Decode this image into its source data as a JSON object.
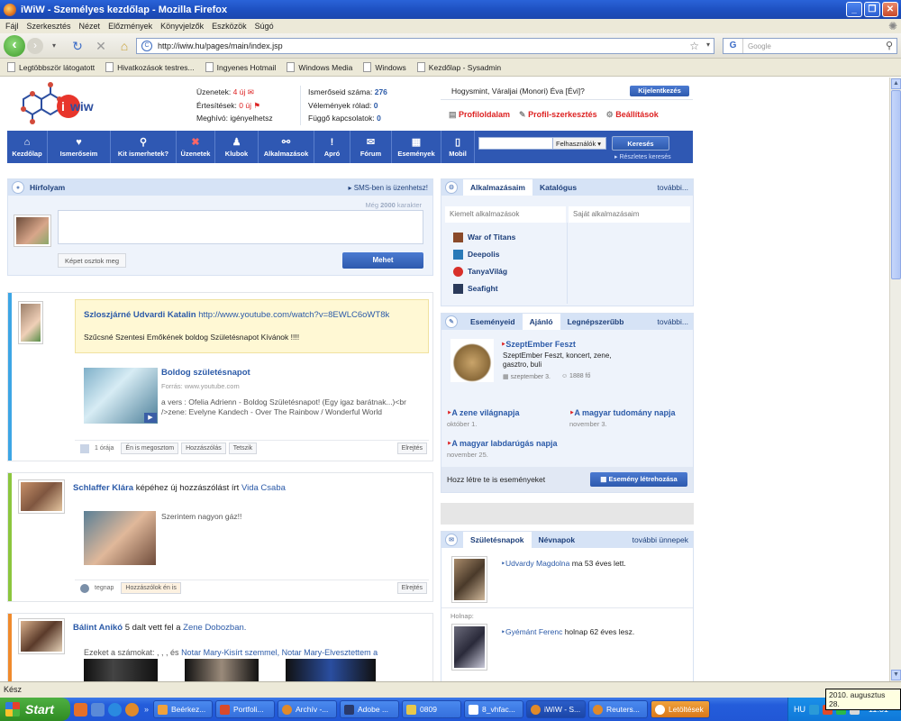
{
  "window": {
    "title": "iWiW - Személyes kezdőlap - Mozilla Firefox"
  },
  "menu": [
    "Fájl",
    "Szerkesztés",
    "Nézet",
    "Előzmények",
    "Könyvjelzők",
    "Eszközök",
    "Súgó"
  ],
  "address": {
    "url": "http://iwiw.hu/pages/main/index.jsp",
    "search_placeholder": "Google"
  },
  "bookmarks": [
    "Legtöbbször látogatott",
    "Hivatkozások testres...",
    "Ingyenes Hotmail",
    "Windows Media",
    "Windows",
    "Kezdőlap - Sysadmin"
  ],
  "header": {
    "col1": {
      "messages_label": "Üzenetek:",
      "messages_value": "4 új",
      "notifications_label": "Értesítések:",
      "notifications_value": "0 új",
      "invite_label": "Meghívó:",
      "invite_value": "igényelhetsz"
    },
    "col2": {
      "friends_label": "Ismerőseid száma:",
      "friends_value": "276",
      "opinions_label": "Vélemények rólad:",
      "opinions_value": "0",
      "pending_label": "Függő kapcsolatok:",
      "pending_value": "0"
    },
    "user_text": "Hogysmint, Váraljai (Monori) Éva [Évi]?",
    "logout": "Kijelentkezés",
    "profile_links": [
      "Profiloldalam",
      "Profil-szerkesztés",
      "Beállítások"
    ]
  },
  "nav": {
    "items": [
      "Kezdőlap",
      "Ismerőseim",
      "Kit ismerhetek?",
      "Üzenetek",
      "Klubok",
      "Alkalmazások",
      "Apró",
      "Fórum",
      "Események",
      "Mobil"
    ],
    "search_placeholder": "",
    "search_select": "Felhasználók",
    "search_button": "Keresés",
    "advanced": "Részletes keresés"
  },
  "feed": {
    "title": "Hírfolyam",
    "sms": "SMS-ben is üzenhetsz!",
    "chars_left_prefix": "Még",
    "chars_left_num": "2000",
    "chars_left_suffix": "karakter",
    "photo_share": "Képet osztok meg",
    "submit": "Mehet"
  },
  "posts": [
    {
      "author": "Szloszjárné Udvardi Katalin",
      "link": "http://www.youtube.com/watch?v=8EWLC6oWT8k",
      "text": "Szűcsné Szentesi Emőkének boldog Születésnapot Kívánok !!!!",
      "video_title": "Boldog születésnapot",
      "video_source": "Forrás: www.youtube.com",
      "video_desc": "a vers : Ofelia Adrienn - Boldog Születésnapot! (Egy igaz barátnak...)<br />zene: Evelyne Kandech - Over The Rainbow / Wonderful World",
      "time": "1 órája",
      "actions": [
        "Én is megosztom",
        "Hozzászólás",
        "Tetszik"
      ],
      "hide": "Elrejtés"
    },
    {
      "author": "Schlaffer Klára",
      "action_text": "képéhez új hozzászólást írt",
      "actor": "Vida Csaba",
      "comment": "Szerintem nagyon gáz!!",
      "time": "tegnap",
      "actions": [
        "Hozzászólok én is"
      ],
      "hide": "Elrejtés"
    },
    {
      "author": "Bálint Anikó",
      "action_text": "5 dalt vett fel a",
      "target": "Zene Dobozban.",
      "songs_prefix": "Ezeket a számokat: , , , és",
      "songs": "Notar Mary-Kisírt szemmel, Notar Mary-Elvesztettem a"
    }
  ],
  "apps": {
    "tabs": [
      "Alkalmazásaim",
      "Katalógus"
    ],
    "more": "további...",
    "featured": "Kiemelt alkalmazások",
    "own": "Saját alkalmazásaim",
    "items": [
      "War of Titans",
      "Deepolis",
      "TanyaVilág",
      "Seafight"
    ]
  },
  "events": {
    "tabs": [
      "Eseményeid",
      "Ajánló",
      "Legnépszerűbb"
    ],
    "more": "további...",
    "featured_title": "SzeptEmber Feszt",
    "featured_desc": "SzeptEmber Feszt, koncert, zene, gasztro, buli",
    "featured_date": "szeptember 3.",
    "featured_count": "1888 fő",
    "items": [
      {
        "title": "A zene világnapja",
        "date": "október 1."
      },
      {
        "title": "A magyar tudomány napja",
        "date": "november 3."
      },
      {
        "title": "A magyar labdarúgás napja",
        "date": "november 25."
      }
    ],
    "create_prompt": "Hozz létre te is eseményeket",
    "create_button": "Esemény létrehozása"
  },
  "birthdays": {
    "tabs": [
      "Születésnapok",
      "Névnapok"
    ],
    "more": "további ünnepek",
    "today_name": "Udvardy Magdolna",
    "today_text": "ma 53 éves lett.",
    "tomorrow_label": "Holnap:",
    "tomorrow_name": "Gyémánt Ferenc",
    "tomorrow_text": "holnap 62 éves lesz."
  },
  "status": {
    "text": "Kész",
    "tooltip": "2010. augusztus 28."
  },
  "taskbar": {
    "start": "Start",
    "tasks": [
      "Beérkez...",
      "Portfoli...",
      "Archív -...",
      "Adobe ...",
      "0809",
      "8_vhfac...",
      "iWiW - S...",
      "Reuters...",
      "Letöltések"
    ],
    "lang": "HU",
    "clock": "11:31"
  },
  "colors": {
    "nav_blue": "#2f58b3",
    "panel_bg": "#eef3fb",
    "accent_red": "#d22222"
  }
}
